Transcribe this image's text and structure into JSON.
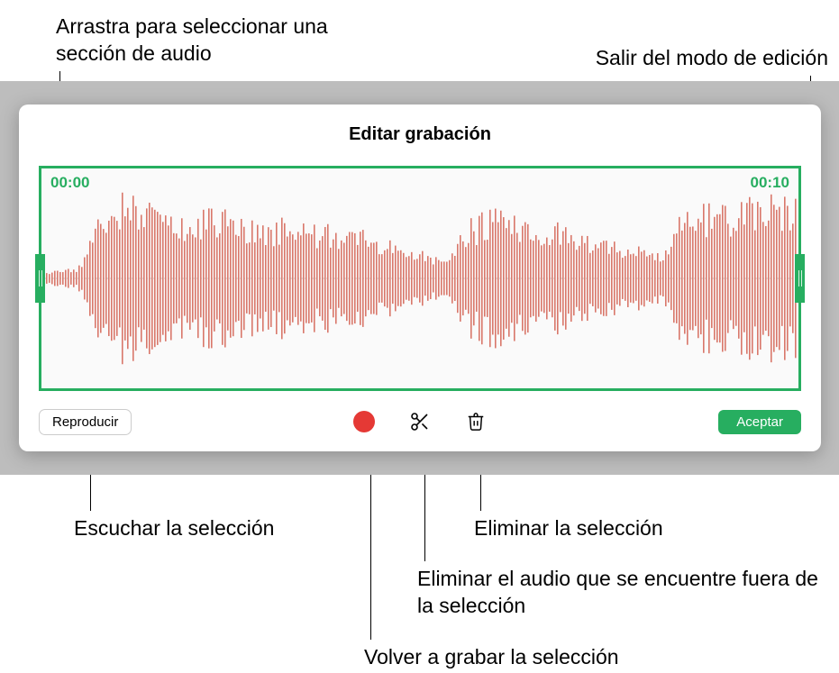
{
  "callouts": {
    "drag_section": "Arrastra para seleccionar una sección de audio",
    "exit_edit": "Salir del modo de edición",
    "listen_selection": "Escuchar la selección",
    "rerecord": "Volver a grabar la selección",
    "trim_outside": "Eliminar el audio que se encuentre fuera de la selección",
    "delete_selection": "Eliminar la selección"
  },
  "panel": {
    "title": "Editar grabación",
    "time_start": "00:00",
    "time_end": "00:10",
    "play_label": "Reproducir",
    "accept_label": "Aceptar"
  },
  "colors": {
    "accent": "#27ae60",
    "waveform": "#d9776a",
    "record": "#e53935"
  }
}
